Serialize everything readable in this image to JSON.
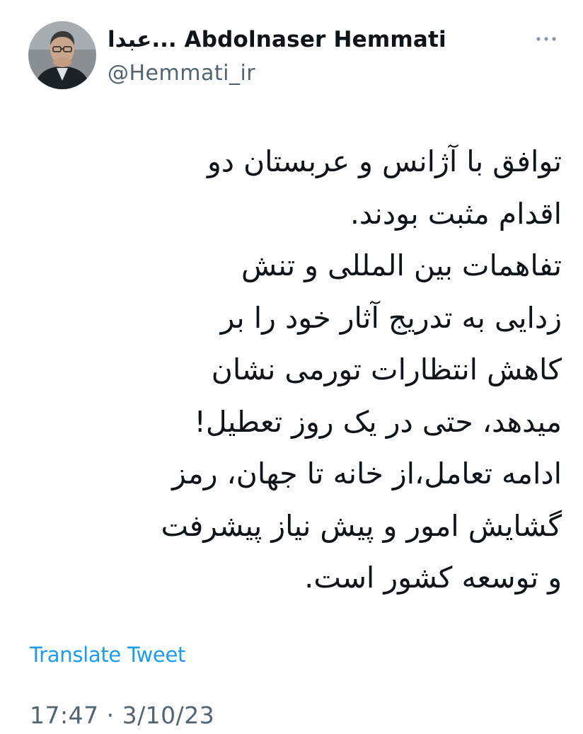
{
  "author": {
    "display_name": "عبدا... Abdolnaser Hemmati",
    "handle": "@Hemmati_ir",
    "avatar_icon": "profile-photo"
  },
  "menu": {
    "icon": "more-horizontal-icon"
  },
  "tweet": {
    "lines": [
      "توافق با آژانس و عربستان دو",
      "اقدام مثبت بودند.",
      "تفاهمات بین المللی و تنش",
      "زدایی به تدریج آثار خود را بر",
      "کاهش انتظارات تورمی نشان",
      "میدهد، حتی در یک روز تعطیل!",
      "ادامه تعامل،از خانه تا جهان، رمز",
      "گشایش امور و پیش نیاز  پیشرفت",
      "و توسعه کشور است."
    ]
  },
  "translate_label": "Translate Tweet",
  "timestamp": "17:47 · 3/10/23",
  "colors": {
    "text": "#0f1419",
    "secondary": "#536471",
    "link": "#1d9bf0"
  }
}
